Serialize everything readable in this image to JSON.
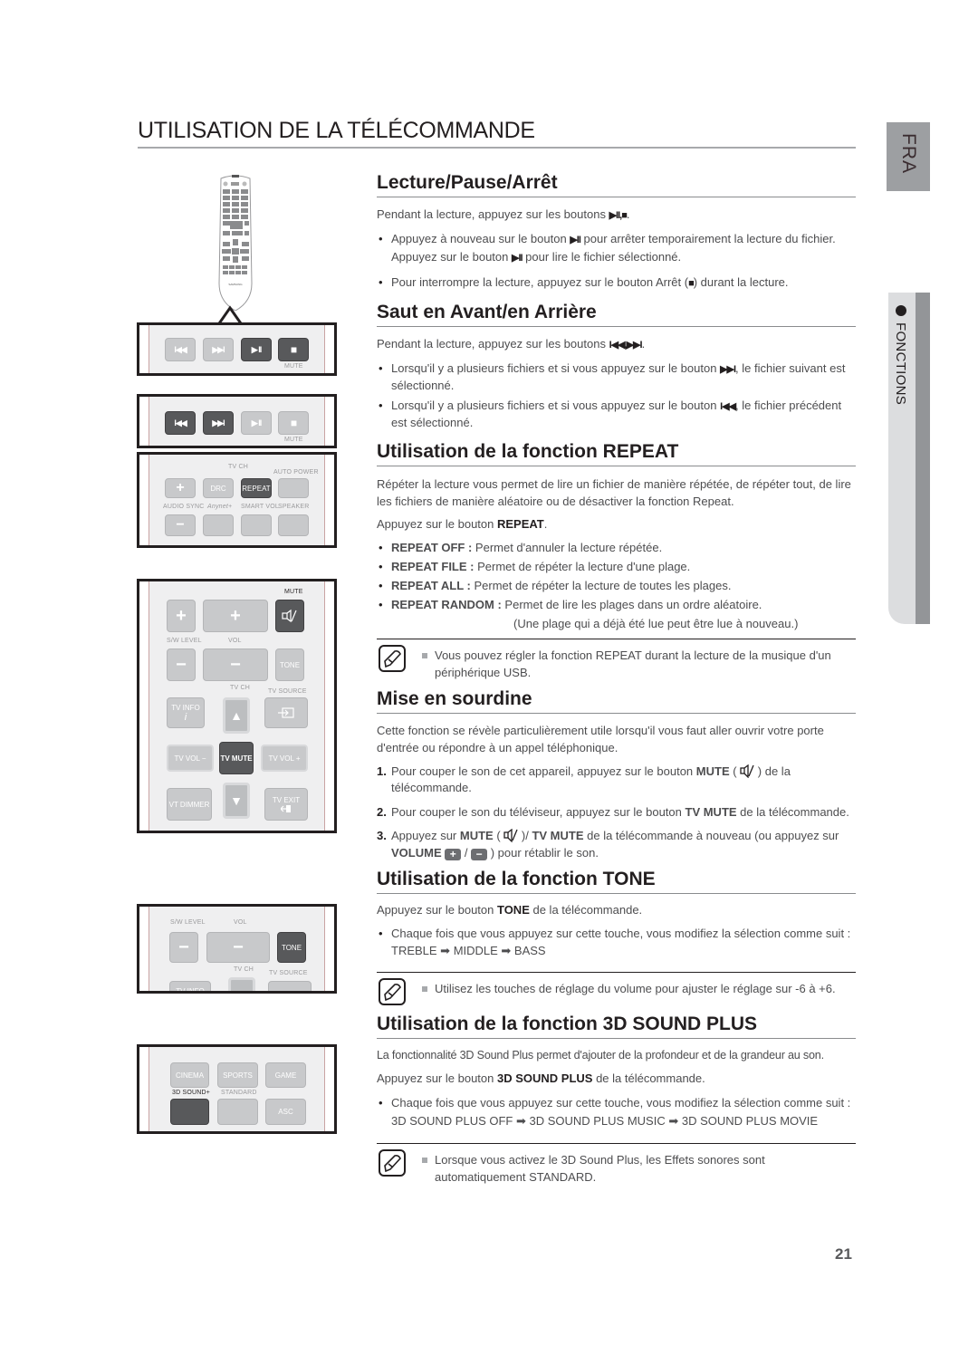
{
  "page": {
    "title": "UTILISATION DE LA TÉLÉCOMMANDE",
    "language_tab": "FRA",
    "section_tab": "FONCTIONS",
    "page_number": "21"
  },
  "sections": {
    "playback": {
      "heading": "Lecture/Pause/Arrêt",
      "intro": "Pendant la lecture, appuyez sur les boutons ",
      "intro_glyph": "▶II,■",
      "intro_end": ".",
      "bullet1_a": "Appuyez à nouveau sur le bouton ",
      "bullet1_glyph": "▶II",
      "bullet1_b": " pour arrêter temporairement la lecture du fichier.",
      "bullet1_c": "Appuyez sur le bouton ",
      "bullet1_d": " pour lire le fichier sélectionné.",
      "bullet2_a": "Pour interrompre la lecture, appuyez sur le bouton Arrêt (",
      "bullet2_glyph": "■",
      "bullet2_b": ") durant la lecture."
    },
    "skip": {
      "heading": "Saut en Avant/en Arrière",
      "intro": "Pendant la lecture, appuyez sur les boutons ",
      "intro_glyph": "I◀◀,▶▶I",
      "intro_end": ".",
      "bullet1_a": "Lorsqu'il y a plusieurs fichiers et si vous appuyez sur le bouton ",
      "bullet1_glyph": "▶▶I",
      "bullet1_b": ", le fichier suivant est sélectionné.",
      "bullet2_a": "Lorsqu'il y a plusieurs fichiers et si vous appuyez sur le bouton ",
      "bullet2_glyph": "I◀◀",
      "bullet2_b": ", le fichier précédent est sélectionné."
    },
    "repeat": {
      "heading": "Utilisation de la fonction REPEAT",
      "intro": "Répéter la lecture vous permet de lire un fichier de manière répétée, de répéter tout, de lire les fichiers de manière aléatoire ou de désactiver la fonction Repeat.",
      "press_a": "Appuyez sur le bouton ",
      "press_b": "REPEAT",
      "press_c": ".",
      "options": [
        {
          "key": "REPEAT OFF :",
          "desc": " Permet d'annuler la lecture répétée."
        },
        {
          "key": "REPEAT FILE :",
          "desc": " Permet de répéter la lecture d'une plage."
        },
        {
          "key": "REPEAT ALL :",
          "desc": " Permet de répéter la lecture de toutes les plages."
        },
        {
          "key": "REPEAT RANDOM :",
          "desc": " Permet de lire les plages dans un ordre aléatoire."
        }
      ],
      "random_note": "(Une plage qui a déjà été lue peut être lue à nouveau.)",
      "note": "Vous pouvez régler la fonction REPEAT durant la lecture de la musique d'un périphérique USB."
    },
    "mute": {
      "heading": "Mise en sourdine",
      "intro": "Cette fonction se révèle particulièrement utile lorsqu'il vous faut aller ouvrir votre porte d'entrée ou répondre à un appel téléphonique.",
      "steps": {
        "s1_num": "1.",
        "s1_a": "Pour couper le son de cet appareil, appuyez sur le bouton ",
        "s1_b": "MUTE",
        "s1_c": " ( ",
        "s1_d": " ) de la télécommande.",
        "s2_num": "2.",
        "s2_a": "Pour couper le son du téléviseur, appuyez sur le bouton ",
        "s2_b": "TV MUTE",
        "s2_c": " de la télécommande.",
        "s3_num": "3.",
        "s3_a": "Appuyez sur ",
        "s3_b": "MUTE",
        "s3_c": " ( ",
        "s3_d": " )/ ",
        "s3_e": "TV MUTE",
        "s3_f": " de la télécommande à nouveau (ou appuyez sur ",
        "s3_g": "VOLUME",
        "s3_plus": "+",
        "s3_sep": " / ",
        "s3_minus": "−",
        "s3_h": " ) pour rétablir le son."
      }
    },
    "tone": {
      "heading": "Utilisation de la fonction TONE",
      "press_a": "Appuyez sur le bouton ",
      "press_b": "TONE",
      "press_c": " de la télécommande.",
      "bullet": "Chaque fois que vous appuyez sur cette touche, vous modifiez la sélection comme suit : TREBLE ➡ MIDDLE ➡ BASS",
      "note": "Utilisez les touches de réglage du volume pour ajuster le réglage sur -6 à +6."
    },
    "sound3d": {
      "heading": "Utilisation de la fonction 3D SOUND PLUS",
      "intro": "La fonctionnalité 3D Sound Plus permet d'ajouter de la profondeur et de la grandeur au son.",
      "press_a": "Appuyez sur le bouton ",
      "press_b": "3D SOUND PLUS",
      "press_c": " de la télécommande.",
      "bullet": "Chaque fois que vous appuyez sur cette touche, vous modifiez la sélection comme suit : 3D SOUND PLUS OFF ➡ 3D SOUND PLUS MUSIC ➡ 3D SOUND PLUS MOVIE",
      "note": "Lorsque vous activez le 3D Sound Plus, les Effets sonores sont automatiquement STANDARD."
    }
  },
  "remote": {
    "brand": "SAMSUNG",
    "transport": {
      "prev": "I◀◀",
      "next": "▶▶I",
      "play_pause": "▶ II",
      "stop": "■",
      "mute_label": "MUTE"
    },
    "repeat_panel": {
      "tv_ch": "TV CH",
      "auto_power": "AUTO POWER",
      "drc": "DRC",
      "repeat": "REPEAT",
      "audio_sync": "AUDIO SYNC",
      "anynet": "Anynet+",
      "smart_vol": "SMART VOL",
      "speaker": "SPEAKER",
      "plus": "+",
      "minus": "−"
    },
    "mute_panel": {
      "mute": "MUTE",
      "sw_level": "S/W LEVEL",
      "vol": "VOL",
      "tone": "TONE",
      "tv_ch": "TV CH",
      "tv_source": "TV SOURCE",
      "tv_info": "TV INFO",
      "info_i": "i",
      "tv_vol_minus": "TV VOL −",
      "tv_mute": "TV MUTE",
      "tv_vol_plus": "TV VOL +",
      "vt_dimmer": "VT DIMMER",
      "tv_exit": "TV EXIT",
      "plus": "+",
      "minus": "−",
      "up": "▲",
      "down": "▼"
    },
    "tone_panel": {
      "sw_level": "S/W LEVEL",
      "vol": "VOL",
      "tone": "TONE",
      "tv_ch": "TV CH",
      "tv_source": "TV SOURCE",
      "tv_info": "TV INFO",
      "minus": "−"
    },
    "sound_panel": {
      "cinema": "CINEMA",
      "sports": "SPORTS",
      "game": "GAME",
      "sound3d": "3D SOUND+",
      "standard": "STANDARD",
      "asc": "ASC"
    }
  }
}
